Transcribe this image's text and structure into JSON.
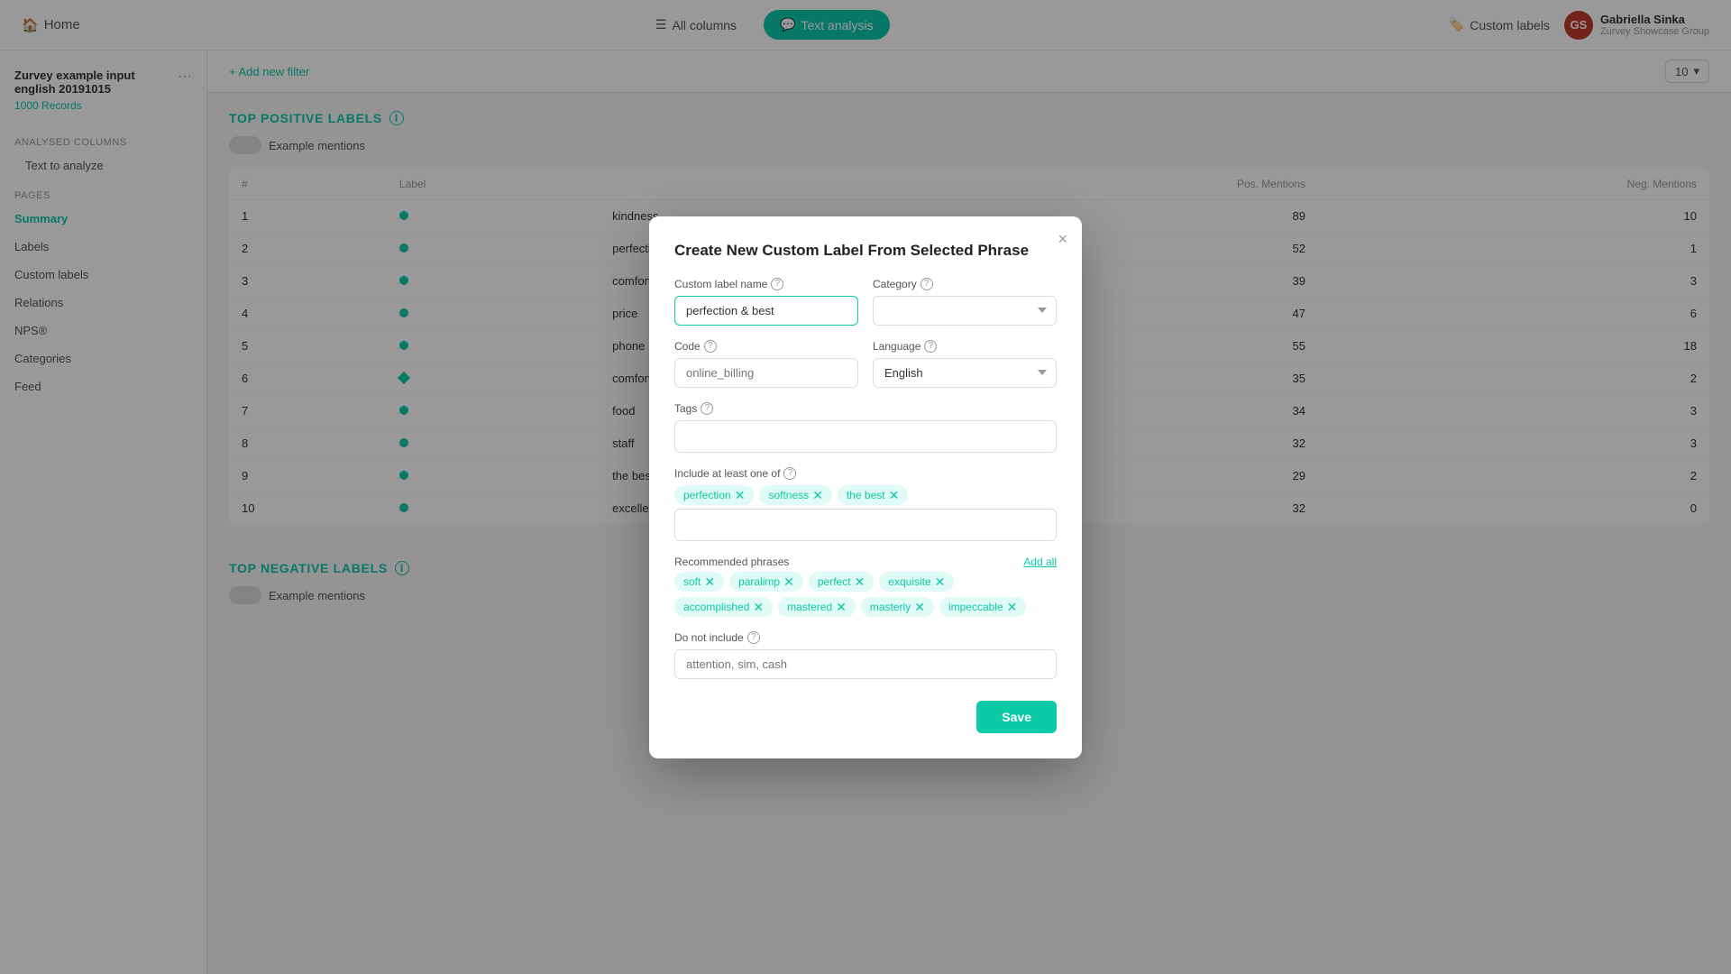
{
  "nav": {
    "home_label": "Home",
    "all_columns_label": "All columns",
    "text_analysis_label": "Text analysis",
    "custom_labels_label": "Custom labels",
    "user_name": "Gabriella Sinka",
    "user_org": "Zurvey Showcase Group"
  },
  "sidebar": {
    "project_title": "Zurvey example input english 20191015",
    "project_records": "1000 Records",
    "analysed_columns": "Analysed columns",
    "text_to_analyze": "Text to analyze",
    "pages": "Pages",
    "summary": "Summary",
    "labels": "Labels",
    "custom_labels": "Custom labels",
    "relations": "Relations",
    "nps": "NPS®",
    "categories": "Categories",
    "feed": "Feed"
  },
  "filter_bar": {
    "add_filter": "+ Add new filter",
    "records_count": "10"
  },
  "top_positive": {
    "title": "TOP POSITIVE LABELS",
    "example_mentions": "Example mentions",
    "columns": {
      "num": "#",
      "label": "Label",
      "pos_mentions": "Pos. Mentions",
      "neg_mentions": "Neg. Mentions"
    },
    "rows": [
      {
        "num": 1,
        "label": "kindness",
        "dot": "circle",
        "pos": 89,
        "neg": 10
      },
      {
        "num": 2,
        "label": "perfection",
        "dot": "circle",
        "pos": 52,
        "neg": 1
      },
      {
        "num": 3,
        "label": "comfort",
        "dot": "circle",
        "pos": 39,
        "neg": 3
      },
      {
        "num": 4,
        "label": "price",
        "dot": "circle",
        "pos": 47,
        "neg": 6
      },
      {
        "num": 5,
        "label": "phone",
        "dot": "circle",
        "pos": 55,
        "neg": 18
      },
      {
        "num": 6,
        "label": "comfort",
        "dot": "diamond",
        "pos": 35,
        "neg": 2
      },
      {
        "num": 7,
        "label": "food",
        "dot": "circle",
        "pos": 34,
        "neg": 3
      },
      {
        "num": 8,
        "label": "staff",
        "dot": "circle",
        "pos": 32,
        "neg": 3
      },
      {
        "num": 9,
        "label": "the best",
        "dot": "circle",
        "pos": 29,
        "neg": 2
      },
      {
        "num": 10,
        "label": "excellence",
        "dot": "circle",
        "pos": 32,
        "neg": 0
      }
    ]
  },
  "top_negative": {
    "title": "TOP NEGATIVE LABELS",
    "example_mentions": "Example mentions"
  },
  "dialog": {
    "title": "Create New Custom Label From Selected Phrase",
    "close": "×",
    "custom_label_name_label": "Custom label name",
    "custom_label_value": "perfection & best",
    "category_label": "Category",
    "code_label": "Code",
    "code_placeholder": "online_billing",
    "language_label": "Language",
    "language_value": "English",
    "tags_label": "Tags",
    "include_label": "Include at least one of",
    "included_chips": [
      "perfection",
      "softness",
      "the best"
    ],
    "recommended_label": "Recommended phrases",
    "add_all": "Add all",
    "recommended_chips": [
      "soft",
      "paralimp",
      "perfect",
      "exquisite",
      "accomplished",
      "mastered",
      "masterly",
      "impeccable"
    ],
    "do_not_include_label": "Do not include",
    "do_not_include_placeholder": "attention, sim, cash",
    "save_btn": "Save"
  }
}
